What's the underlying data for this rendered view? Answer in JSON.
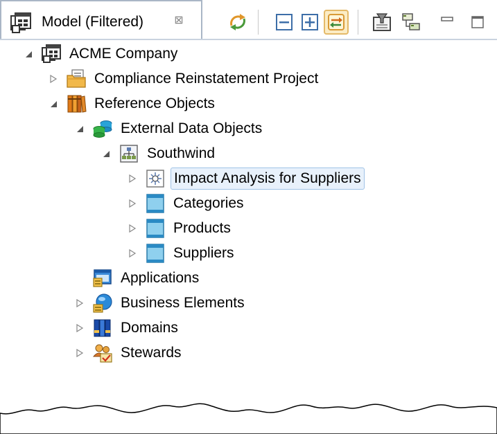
{
  "panel": {
    "tab_title": "Model (Filtered)",
    "tab_close_symbol": "⊠",
    "accent_color": "#e4b968",
    "selection_color": "#e8f1fb"
  },
  "toolbar": {
    "buttons": [
      {
        "name": "sync-icon",
        "pressed": false
      },
      {
        "name": "collapse-all-icon",
        "pressed": false
      },
      {
        "name": "expand-all-icon",
        "pressed": false
      },
      {
        "name": "link-with-editor-icon",
        "pressed": true
      },
      {
        "name": "filter-icon",
        "pressed": false
      },
      {
        "name": "hierarchy-icon",
        "pressed": false
      },
      {
        "name": "minimize-icon",
        "pressed": false
      },
      {
        "name": "maximize-icon",
        "pressed": false
      }
    ]
  },
  "tree": {
    "nodes": [
      {
        "label": "ACME Company",
        "icon": "company-icon",
        "state": "expanded",
        "depth": 0
      },
      {
        "label": "Compliance Reinstatement Project",
        "icon": "project-folder-icon",
        "state": "collapsed",
        "depth": 1
      },
      {
        "label": "Reference Objects",
        "icon": "books-icon",
        "state": "expanded",
        "depth": 1
      },
      {
        "label": "External Data Objects",
        "icon": "database-icon",
        "state": "expanded",
        "depth": 2
      },
      {
        "label": "Southwind",
        "icon": "schema-icon",
        "state": "expanded",
        "depth": 3
      },
      {
        "label": "Impact Analysis for Suppliers",
        "icon": "impact-analysis-icon",
        "state": "collapsed",
        "depth": 4,
        "selected": true
      },
      {
        "label": "Categories",
        "icon": "table-icon",
        "state": "collapsed",
        "depth": 4
      },
      {
        "label": "Products",
        "icon": "table-icon",
        "state": "collapsed",
        "depth": 4
      },
      {
        "label": "Suppliers",
        "icon": "table-icon",
        "state": "collapsed",
        "depth": 4
      },
      {
        "label": "Applications",
        "icon": "application-icon",
        "state": "leaf",
        "depth": 2
      },
      {
        "label": "Business Elements",
        "icon": "business-element-icon",
        "state": "collapsed",
        "depth": 2
      },
      {
        "label": "Domains",
        "icon": "domains-icon",
        "state": "collapsed",
        "depth": 2
      },
      {
        "label": "Stewards",
        "icon": "stewards-icon",
        "state": "collapsed",
        "depth": 2
      }
    ]
  }
}
